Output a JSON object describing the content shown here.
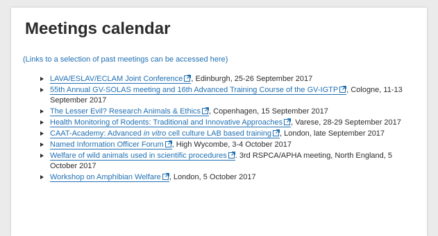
{
  "page": {
    "title": "Meetings calendar",
    "past_open": "(",
    "past_link": "Links to a selection of past meetings can be accessed here",
    "past_close": ")"
  },
  "meetings": [
    {
      "link": "LAVA/ESLAV/ECLAM Joint Conference",
      "details": ", Edinburgh, 25-26 September 2017"
    },
    {
      "link": "55th Annual GV-SOLAS meeting and 16th Advanced Training Course of the GV-IGTP",
      "details": ", Cologne, 11-13 September 2017"
    },
    {
      "link": "The Lesser Evil? Research Animals & Ethics",
      "details": ", Copenhagen, 15 September 2017"
    },
    {
      "link": "Health Monitoring of Rodents: Traditional and Innovative Approaches",
      "details": ", Varese, 28-29 September 2017"
    },
    {
      "link_pre": "CAAT-Academy: Advanced ",
      "link_em": "in vitro",
      "link_post": " cell culture LAB based training",
      "details": ", London, late September 2017"
    },
    {
      "link": "Named Information Officer Forum",
      "details": ", High Wycombe, 3-4 October 2017"
    },
    {
      "link": "Welfare of wild animals used in scientific procedures",
      "details": ". 3rd RSPCA/APHA meeting, North England, 5 October 2017"
    },
    {
      "link": "Workshop on Amphibian Welfare",
      "details": ", London, 5 October 2017"
    }
  ],
  "icons": {
    "bullet": "triangle-bullet-icon",
    "external": "external-link-icon"
  },
  "colors": {
    "link": "#1f6fb2",
    "text": "#2b2b2b",
    "background": "#ffffff"
  }
}
